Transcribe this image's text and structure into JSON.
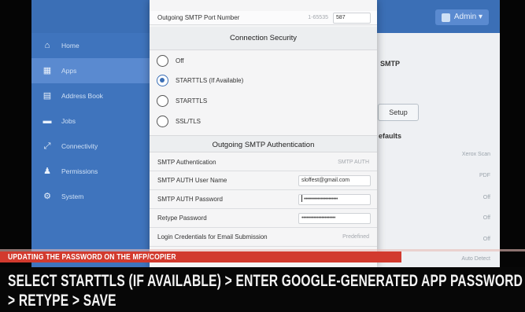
{
  "topbar": {
    "admin_label": "Admin ▾"
  },
  "sidebar": {
    "items": [
      {
        "label": "Home",
        "icon": "home-icon",
        "glyph": "⌂"
      },
      {
        "label": "Apps",
        "icon": "apps-icon",
        "glyph": "▦",
        "active": true
      },
      {
        "label": "Address Book",
        "icon": "address-book-icon",
        "glyph": "▤"
      },
      {
        "label": "Jobs",
        "icon": "jobs-icon",
        "glyph": "▬"
      },
      {
        "label": "Connectivity",
        "icon": "connectivity-icon",
        "glyph": "⤢"
      },
      {
        "label": "Permissions",
        "icon": "permissions-icon",
        "glyph": "♟"
      },
      {
        "label": "System",
        "icon": "system-icon",
        "glyph": "⚙"
      }
    ]
  },
  "background": {
    "smtp_label": "SMTP",
    "setup_label": "Setup",
    "defaults_label": "efaults",
    "values": [
      "Xerox Scan",
      "PDF",
      "Off",
      "Off",
      "Off",
      "Auto Detect"
    ],
    "letter_to": "To",
    "letter_di": "Di"
  },
  "modal": {
    "port_label": "Outgoing SMTP Port Number",
    "port_hint": "1-65535",
    "port_value": "587",
    "security_heading": "Connection Security",
    "security_options": [
      {
        "label": "Off",
        "selected": false
      },
      {
        "label": "STARTTLS (If Available)",
        "selected": true
      },
      {
        "label": "STARTTLS",
        "selected": false
      },
      {
        "label": "SSL/TLS",
        "selected": false
      }
    ],
    "auth_heading": "Outgoing SMTP Authentication",
    "auth_label": "SMTP Authentication",
    "auth_value": "SMTP AUTH",
    "username_label": "SMTP AUTH User Name",
    "username_value": "sloffest@gmail.com",
    "password_label": "SMTP AUTH Password",
    "password_value": "••••••••••••••••••••••",
    "retype_label": "Retype Password",
    "retype_value": "••••••••••••••••••••••",
    "login_label": "Login Credentials for Email Submission",
    "login_value": "Predefined"
  },
  "captions": {
    "subtitle_bar": "UPDATING THE PASSWORD ON THE MFP/COPIER",
    "line1": "SELECT STARTTLS (IF AVAILABLE) > ENTER GOOGLE-GENERATED APP PASSWORD",
    "line2": "> RETYPE > SAVE"
  },
  "colors": {
    "accent": "#3b6fb6",
    "caption_red": "#d23a2e"
  }
}
